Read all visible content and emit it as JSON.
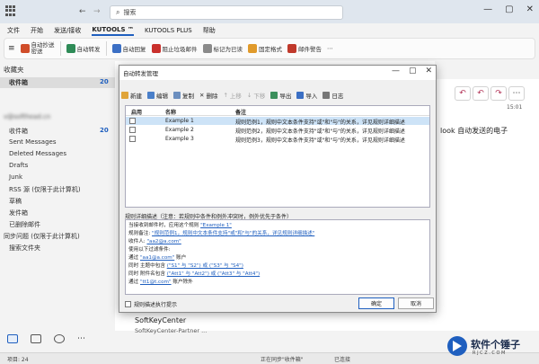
{
  "search": {
    "placeholder": "搜索"
  },
  "tabs": [
    "文件",
    "开始",
    "发送/接收",
    "KUTOOLS ™",
    "KUTOOLS PLUS",
    "帮助"
  ],
  "ribbon": {
    "items": [
      "自动抄送\n密送",
      "自动转发",
      "自动回复",
      "阻止垃圾邮件",
      "标记为已读",
      "固定格式",
      "邮件警告"
    ]
  },
  "leftnav": {
    "favorites": "收藏夹",
    "inbox_fav": "收件箱",
    "inbox_fav_count": "20",
    "account": "v@softhead.cn",
    "inbox": "收件箱",
    "inbox_count": "20",
    "items": [
      "Sent Messages",
      "Deleted Messages",
      "Drafts",
      "Junk",
      "RSS 源 (仅限于此计算机)",
      "草稿",
      "发件箱",
      "已删除邮件",
      "同步问题 (仅限于此计算机)",
      "搜索文件夹"
    ]
  },
  "rightpane": {
    "time": "15:01",
    "snippet": "look 自动发送的电子"
  },
  "dialog": {
    "title": "自动转发管理",
    "toolbar": {
      "new": "新建",
      "edit": "编辑",
      "copy": "复制",
      "delete": "删除",
      "up": "上移",
      "down": "下移",
      "export": "导出",
      "import": "导入",
      "log": "日志"
    },
    "columns": {
      "enable": "启用",
      "name": "名称",
      "note": "备注"
    },
    "rules": [
      {
        "name": "Example 1",
        "note": "规则范例1，规则中文本条件支持\"或\"和\"与\"的关系，详见规则详细描述"
      },
      {
        "name": "Example 2",
        "note": "规则范例2，规则中文本条件支持\"或\"和\"与\"的关系，详见规则详细描述"
      },
      {
        "name": "Example 3",
        "note": "规则范例3，规则中文本条件支持\"或\"和\"与\"的关系，详见规则详细描述"
      }
    ],
    "desc_label": "规则详细描述（注意：若规则中条件和例外冲突时，例外优先于条件）",
    "desc": {
      "l1a": "当接收到邮件时，应用这个规则 ",
      "l1b": "\"Example 1\"",
      "l2a": "规则备注: ",
      "l2b": "\"规则范例1，规则中文本条件支持\"或\"和\"与\"的关系，详见规则详细描述\"",
      "l3a": "收件人: ",
      "l3b": "\"aa2@a.com\"",
      "l4": "使用以下过滤条件:",
      "l5a": "通过 ",
      "l5b": "\"aa1@a.com\"",
      "l5c": " 账户",
      "l6a": "  同时 主题中包含 ",
      "l6b": "(\"S1\" 与 \"S2\") 或 (\"S3\" 与 \"S4\")",
      "l7a": "  同时 附件名包含 ",
      "l7b": "(\"Att1\" 与 \"Att2\") 或 (\"Att3\" 与 \"Att4\")",
      "l8a": "通过 ",
      "l8b": "\"tt1@t.com\"",
      "l8c": " 账户除外"
    },
    "show_desc": "规则描述执行提示",
    "ok": "确定",
    "cancel": "取消"
  },
  "mailpreview": {
    "sender": "SoftKeyCenter",
    "line": "SoftKeyCenter-Partner ..."
  },
  "statusbar": {
    "left": "项目: 24",
    "middle": "正在同步\"收件箱\"",
    "right": "已连接"
  },
  "watermark": {
    "title": "软件个锤子",
    "sub": "R J C Z . C O M"
  }
}
